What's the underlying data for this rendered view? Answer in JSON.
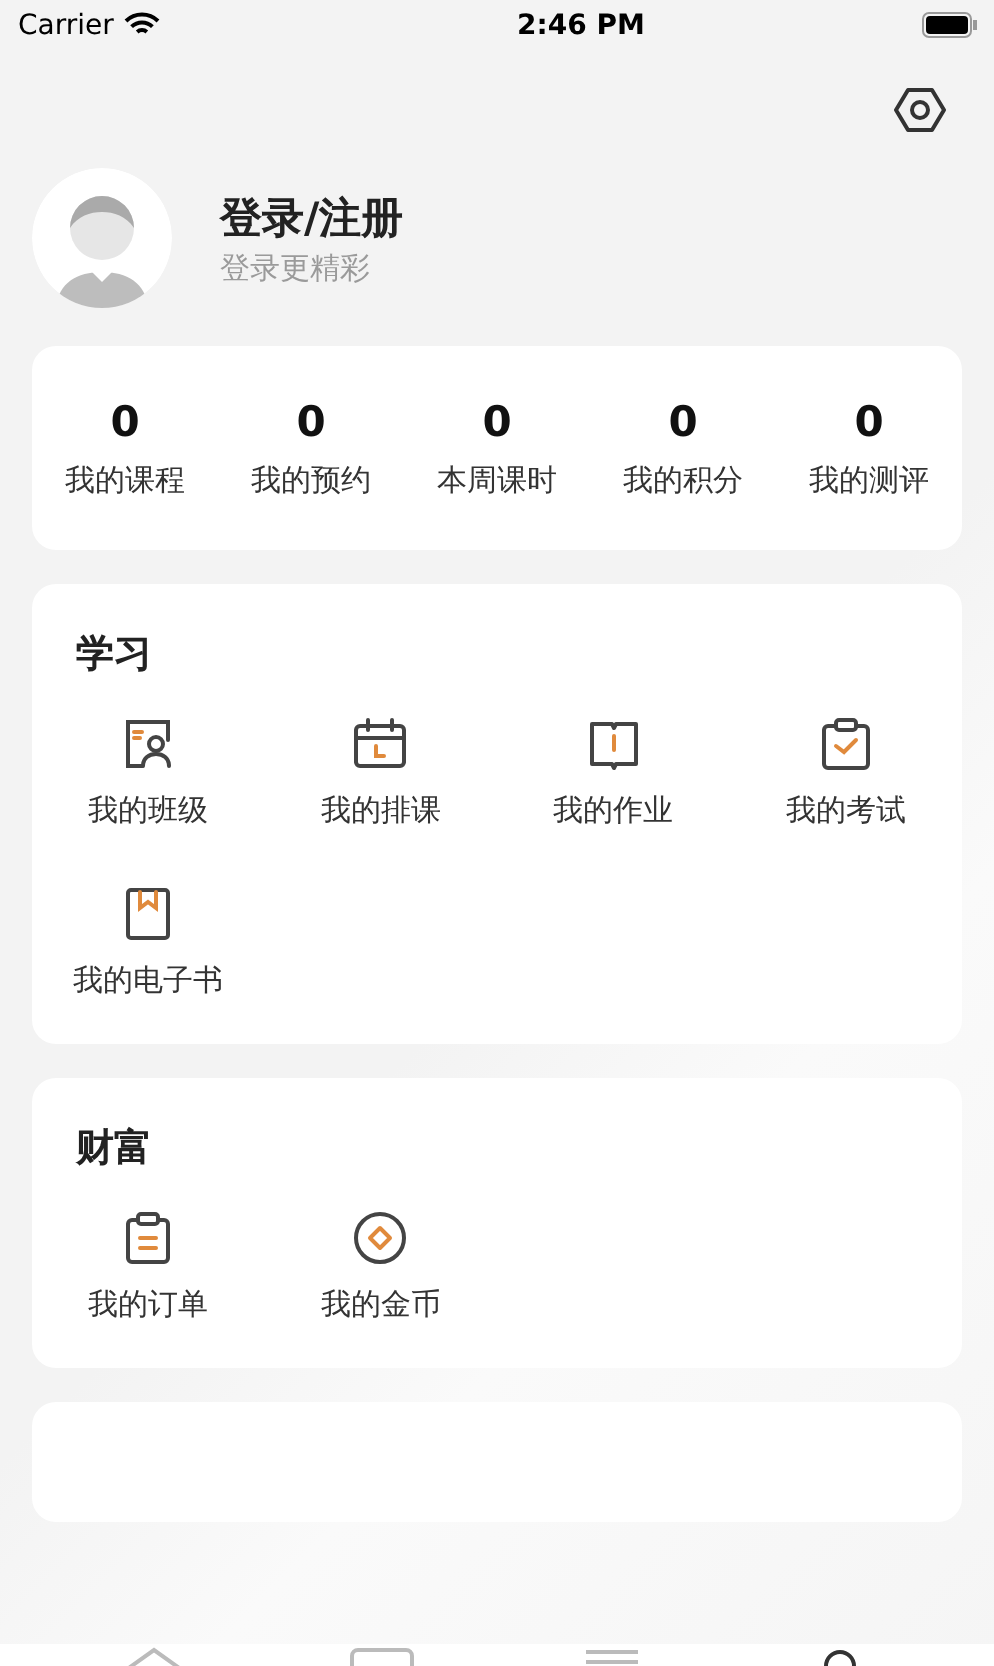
{
  "status_bar": {
    "carrier": "Carrier",
    "time": "2:46 PM"
  },
  "profile": {
    "name": "登录/注册",
    "subtitle": "登录更精彩"
  },
  "stats": [
    {
      "value": "0",
      "label": "我的课程"
    },
    {
      "value": "0",
      "label": "我的预约"
    },
    {
      "value": "0",
      "label": "本周课时"
    },
    {
      "value": "0",
      "label": "我的积分"
    },
    {
      "value": "0",
      "label": "我的测评"
    }
  ],
  "sections": [
    {
      "title": "学习",
      "items": [
        {
          "kind": "class",
          "label": "我的班级"
        },
        {
          "kind": "schedule",
          "label": "我的排课"
        },
        {
          "kind": "homework",
          "label": "我的作业"
        },
        {
          "kind": "exam",
          "label": "我的考试"
        },
        {
          "kind": "ebook",
          "label": "我的电子书"
        }
      ]
    },
    {
      "title": "财富",
      "items": [
        {
          "kind": "order",
          "label": "我的订单"
        },
        {
          "kind": "coin",
          "label": "我的金币"
        }
      ]
    }
  ],
  "tab_bar": [
    {
      "kind": "home"
    },
    {
      "kind": "course"
    },
    {
      "kind": "list"
    },
    {
      "kind": "profile"
    }
  ]
}
